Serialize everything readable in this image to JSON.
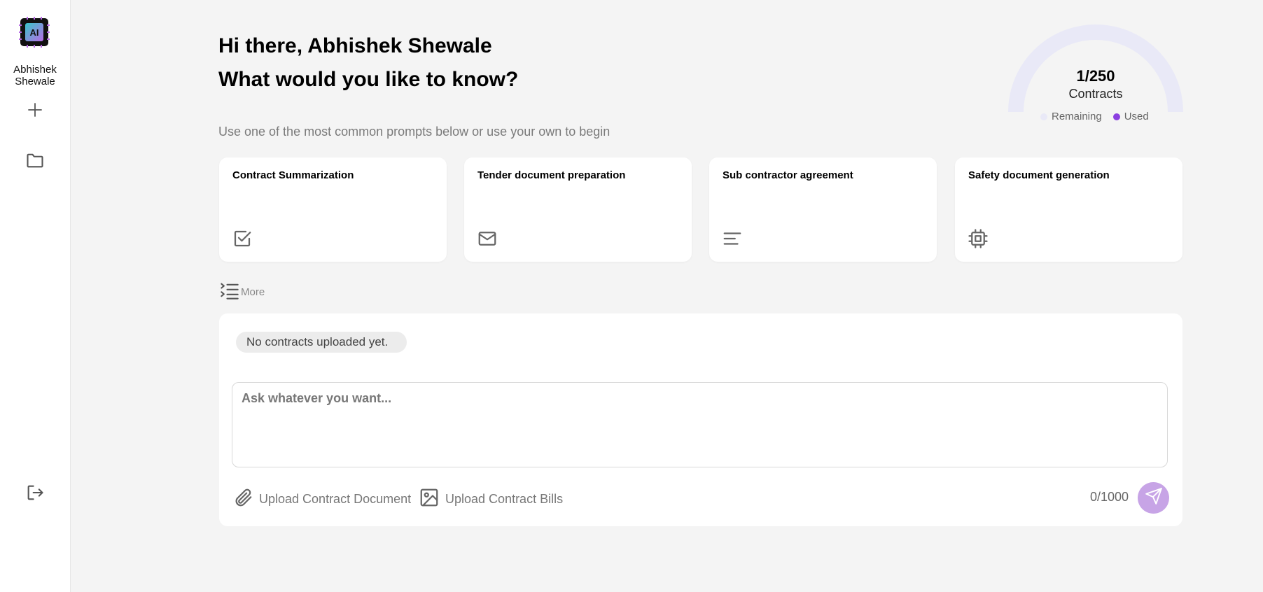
{
  "sidebar": {
    "logo_text": "AI",
    "user_name": "Abhishek Shewale",
    "icons": [
      "plus-icon",
      "folder-icon",
      "logout-icon"
    ]
  },
  "header": {
    "greeting": "Hi there, Abhishek Shewale",
    "question": "What would you like to know?",
    "subtitle": "Use one of the most common prompts below or use your own to begin"
  },
  "usage": {
    "count_label": "1/250",
    "unit_label": "Contracts",
    "used": 1,
    "total": 250,
    "legend_remaining": "Remaining",
    "legend_used": "Used",
    "colors": {
      "remaining": "#e9e9f7",
      "used": "#8b3fe0"
    }
  },
  "prompts": [
    {
      "title": "Contract Summarization",
      "icon": "check-square-icon"
    },
    {
      "title": "Tender document preparation",
      "icon": "mail-icon"
    },
    {
      "title": "Sub contractor agreement",
      "icon": "align-left-icon"
    },
    {
      "title": "Safety document generation",
      "icon": "cpu-icon"
    }
  ],
  "more_label": "More",
  "chat": {
    "status_pill": "No contracts uploaded yet.",
    "input_placeholder": "Ask whatever you want...",
    "upload_document_label": "Upload Contract Document",
    "upload_bills_label": "Upload Contract Bills",
    "char_counter": "0/1000",
    "send_color": "#c7a4e6"
  }
}
